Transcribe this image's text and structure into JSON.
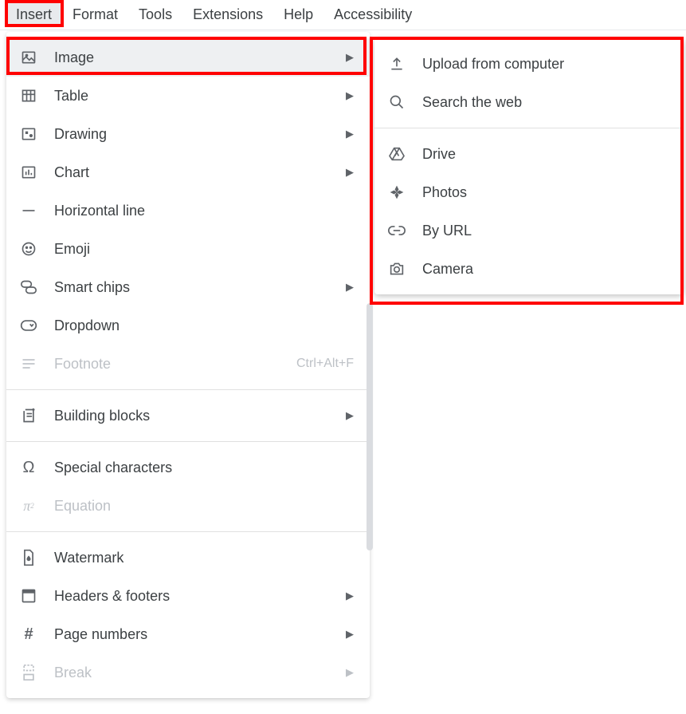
{
  "menubar": {
    "items": [
      {
        "label": "Insert"
      },
      {
        "label": "Format"
      },
      {
        "label": "Tools"
      },
      {
        "label": "Extensions"
      },
      {
        "label": "Help"
      },
      {
        "label": "Accessibility"
      }
    ]
  },
  "insert_menu": {
    "items": [
      {
        "label": "Image",
        "submenu": true
      },
      {
        "label": "Table",
        "submenu": true
      },
      {
        "label": "Drawing",
        "submenu": true
      },
      {
        "label": "Chart",
        "submenu": true
      },
      {
        "label": "Horizontal line"
      },
      {
        "label": "Emoji"
      },
      {
        "label": "Smart chips",
        "submenu": true
      },
      {
        "label": "Dropdown"
      },
      {
        "label": "Footnote",
        "shortcut": "Ctrl+Alt+F"
      },
      {
        "label": "Building blocks",
        "submenu": true
      },
      {
        "label": "Special characters"
      },
      {
        "label": "Equation",
        "disabled": true
      },
      {
        "label": "Watermark"
      },
      {
        "label": "Headers & footers",
        "submenu": true
      },
      {
        "label": "Page numbers",
        "submenu": true
      },
      {
        "label": "Break",
        "submenu": true,
        "disabled": true
      }
    ]
  },
  "image_submenu": {
    "items": [
      {
        "label": "Upload from computer"
      },
      {
        "label": "Search the web"
      },
      {
        "label": "Drive"
      },
      {
        "label": "Photos"
      },
      {
        "label": "By URL"
      },
      {
        "label": "Camera"
      }
    ]
  }
}
